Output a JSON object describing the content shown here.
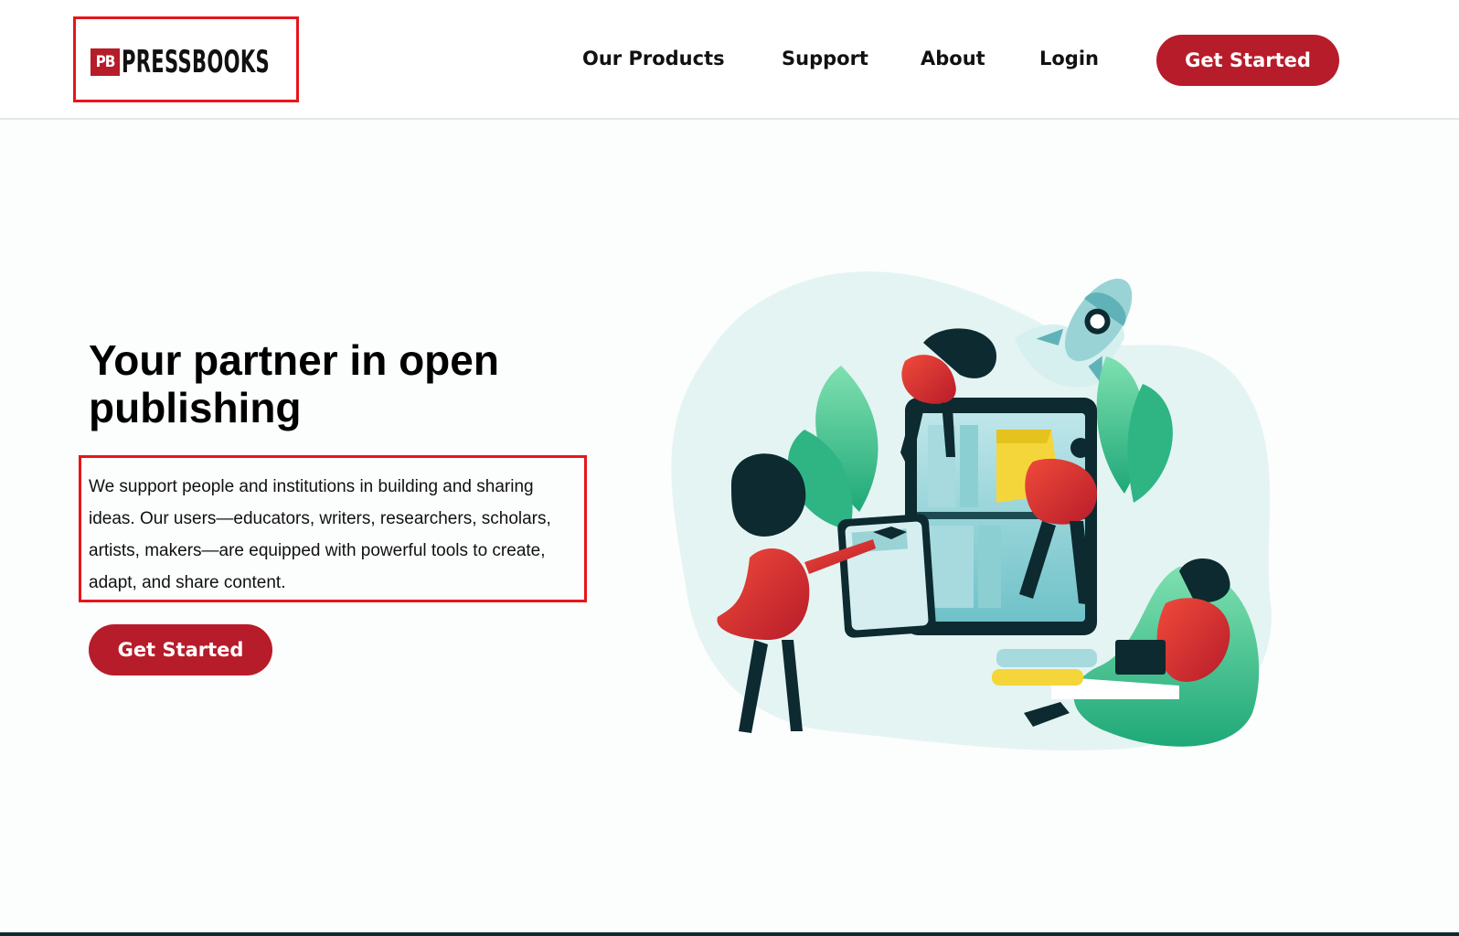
{
  "header": {
    "logo": {
      "mark": "PB",
      "text": "PRESSBOOKS"
    },
    "nav": [
      {
        "label": "Our Products"
      },
      {
        "label": "Support"
      },
      {
        "label": "About"
      },
      {
        "label": "Login"
      }
    ],
    "cta_label": "Get Started"
  },
  "hero": {
    "title": "Your partner in open publishing",
    "description": "We support people and institutions in building and sharing ideas. Our users—educators, writers, researchers, scholars, artists, makers—are equipped with powerful tools to create, adapt, and share content.",
    "cta_label": "Get Started"
  },
  "colors": {
    "brand_red": "#b71c2a",
    "highlight_red": "#e8151b",
    "teal_dark": "#0c2a2f",
    "mint": "#e4f4f3",
    "green": "#3cbf8a"
  }
}
